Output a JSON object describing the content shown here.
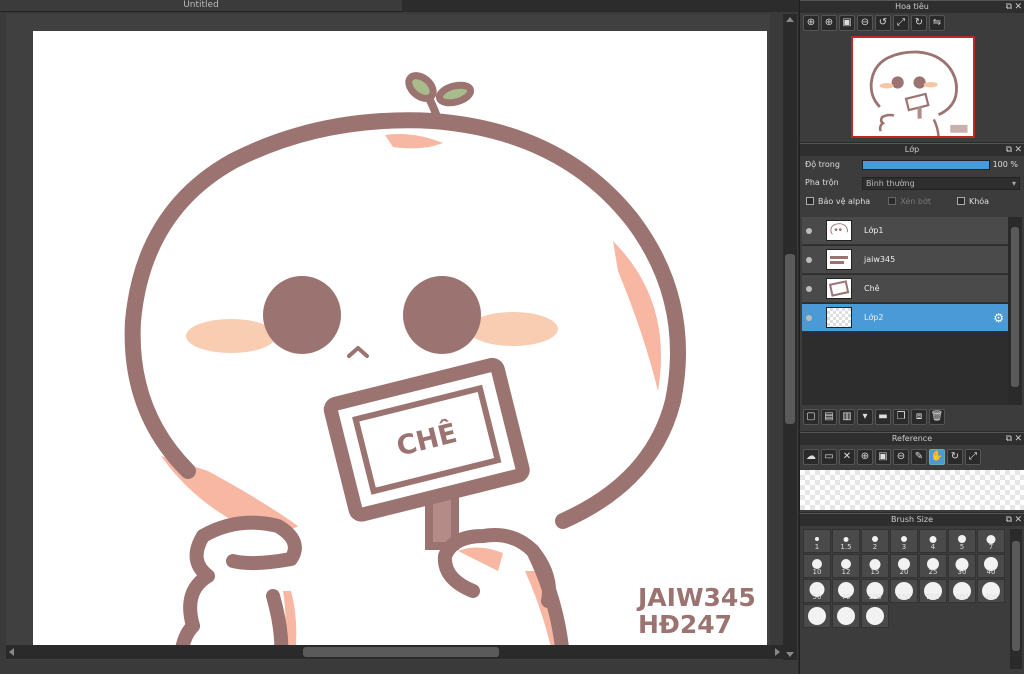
{
  "document": {
    "tab_title": "Untitled"
  },
  "artwork": {
    "sign_text": "CHÊ",
    "signature_line1": "JAIW345",
    "signature_line2": "HĐ247"
  },
  "navigator": {
    "title": "Hoa tiêu",
    "tools": [
      "zoom-icon",
      "zoom-in-icon",
      "fit-icon",
      "zoom-out-icon",
      "rotate-left-icon",
      "actual-size-icon",
      "rotate-right-icon",
      "flip-icon"
    ]
  },
  "layers": {
    "title": "Lớp",
    "opacity_label": "Độ trong",
    "opacity_value": "100 %",
    "opacity_fraction": 1.0,
    "blend_label": "Pha trộn",
    "blend_value": "Bình thường",
    "protect_alpha": "Bảo vệ alpha",
    "clipping": "Xén bớt",
    "lock": "Khóa",
    "items": [
      {
        "name": "Lớp1",
        "selected": false
      },
      {
        "name": "jaiw345",
        "selected": false
      },
      {
        "name": "Chê",
        "selected": false
      },
      {
        "name": "Lớp2",
        "selected": true
      }
    ]
  },
  "reference": {
    "title": "Reference"
  },
  "brush_size": {
    "title": "Brush Size",
    "sizes": [
      "1",
      "1.5",
      "2",
      "3",
      "4",
      "5",
      "7",
      "10",
      "12",
      "15",
      "20",
      "25",
      "30",
      "40",
      "50",
      "70",
      "100",
      "150",
      "200",
      "300",
      "400",
      "",
      "",
      ""
    ]
  },
  "colors": {
    "accent": "#4a9ad8",
    "stroke": "#9b7370",
    "blush": "#f7b7a3",
    "sprout": "#a9bb8a",
    "nav_border": "#c0272d"
  }
}
